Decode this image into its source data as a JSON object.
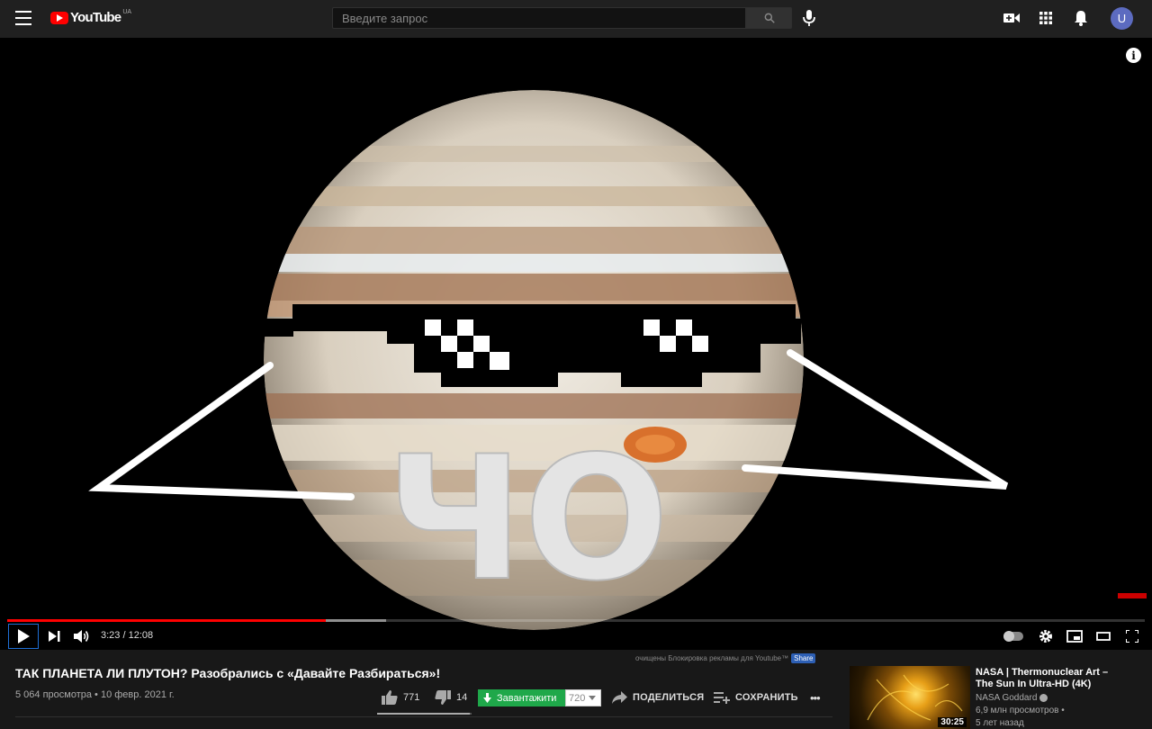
{
  "masthead": {
    "logo_text": "YouTube",
    "logo_country": "UA",
    "search_placeholder": "Введите запрос",
    "avatar_letter": "U"
  },
  "player": {
    "current_time": "3:23",
    "duration": "12:08",
    "time_display": "3:23 / 12:08",
    "progress_fraction": 0.28,
    "buffered_fraction": 0.333,
    "overlay_text": "ЧО"
  },
  "video": {
    "title": "ТАК ПЛАНЕТА ЛИ ПЛУТОН? Разобрались с «Давайте Разбираться»!",
    "meta": "5 064 просмотра • 10 февр. 2021 г.",
    "likes": "771",
    "dislikes": "14",
    "like_fraction": 0.982,
    "share_label": "ПОДЕЛИТЬСЯ",
    "save_label": "СОХРАНИТЬ",
    "more_label": "•••"
  },
  "extension": {
    "adblock_note": "очищены Блокировка рекламы для Youtube™",
    "share_badge": "Share",
    "download_label": "Завантажити",
    "quality": "720"
  },
  "related": {
    "title": "NASA | Thermonuclear Art – The Sun In Ultra-HD (4K)",
    "channel": "NASA Goddard",
    "views": "6,9 млн просмотров •",
    "age": "5 лет назад",
    "duration": "30:25"
  },
  "colors": {
    "background": "#181818",
    "masthead": "#202020",
    "progress": "#ff0000",
    "download": "#1fa84a",
    "avatar": "#5c6bc0"
  }
}
